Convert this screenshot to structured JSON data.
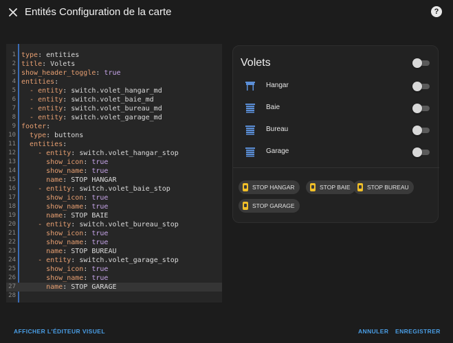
{
  "dialog": {
    "title": "Entités Configuration de la carte",
    "help_glyph": "?"
  },
  "yaml_lines": [
    {
      "n": "1",
      "parts": [
        [
          "k",
          "type"
        ],
        [
          "t",
          ": entities"
        ]
      ]
    },
    {
      "n": "2",
      "parts": [
        [
          "k",
          "title"
        ],
        [
          "t",
          ": Volets"
        ]
      ]
    },
    {
      "n": "3",
      "parts": [
        [
          "k",
          "show_header_toggle"
        ],
        [
          "t",
          ": "
        ],
        [
          "v",
          "true"
        ]
      ]
    },
    {
      "n": "4",
      "parts": [
        [
          "k",
          "entities"
        ],
        [
          "t",
          ":"
        ]
      ]
    },
    {
      "n": "5",
      "parts": [
        [
          "t",
          "  "
        ],
        [
          "d",
          "-"
        ],
        [
          "t",
          " "
        ],
        [
          "k",
          "entity"
        ],
        [
          "t",
          ": switch.volet_hangar_md"
        ]
      ]
    },
    {
      "n": "6",
      "parts": [
        [
          "t",
          "  "
        ],
        [
          "d",
          "-"
        ],
        [
          "t",
          " "
        ],
        [
          "k",
          "entity"
        ],
        [
          "t",
          ": switch.volet_baie_md"
        ]
      ]
    },
    {
      "n": "7",
      "parts": [
        [
          "t",
          "  "
        ],
        [
          "d",
          "-"
        ],
        [
          "t",
          " "
        ],
        [
          "k",
          "entity"
        ],
        [
          "t",
          ": switch.volet_bureau_md"
        ]
      ]
    },
    {
      "n": "8",
      "parts": [
        [
          "t",
          "  "
        ],
        [
          "d",
          "-"
        ],
        [
          "t",
          " "
        ],
        [
          "k",
          "entity"
        ],
        [
          "t",
          ": switch.volet_garage_md"
        ]
      ]
    },
    {
      "n": "9",
      "parts": [
        [
          "k",
          "footer"
        ],
        [
          "t",
          ":"
        ]
      ]
    },
    {
      "n": "10",
      "parts": [
        [
          "t",
          "  "
        ],
        [
          "k",
          "type"
        ],
        [
          "t",
          ": buttons"
        ]
      ]
    },
    {
      "n": "11",
      "parts": [
        [
          "t",
          "  "
        ],
        [
          "k",
          "entities"
        ],
        [
          "t",
          ":"
        ]
      ]
    },
    {
      "n": "12",
      "parts": [
        [
          "t",
          "    "
        ],
        [
          "d",
          "-"
        ],
        [
          "t",
          " "
        ],
        [
          "k",
          "entity"
        ],
        [
          "t",
          ": switch.volet_hangar_stop"
        ]
      ]
    },
    {
      "n": "13",
      "parts": [
        [
          "t",
          "      "
        ],
        [
          "k",
          "show_icon"
        ],
        [
          "t",
          ": "
        ],
        [
          "v",
          "true"
        ]
      ]
    },
    {
      "n": "14",
      "parts": [
        [
          "t",
          "      "
        ],
        [
          "k",
          "show_name"
        ],
        [
          "t",
          ": "
        ],
        [
          "v",
          "true"
        ]
      ]
    },
    {
      "n": "15",
      "parts": [
        [
          "t",
          "      "
        ],
        [
          "k",
          "name"
        ],
        [
          "t",
          ": STOP HANGAR"
        ]
      ]
    },
    {
      "n": "16",
      "parts": [
        [
          "t",
          "    "
        ],
        [
          "d",
          "-"
        ],
        [
          "t",
          " "
        ],
        [
          "k",
          "entity"
        ],
        [
          "t",
          ": switch.volet_baie_stop"
        ]
      ]
    },
    {
      "n": "17",
      "parts": [
        [
          "t",
          "      "
        ],
        [
          "k",
          "show_icon"
        ],
        [
          "t",
          ": "
        ],
        [
          "v",
          "true"
        ]
      ]
    },
    {
      "n": "18",
      "parts": [
        [
          "t",
          "      "
        ],
        [
          "k",
          "show_name"
        ],
        [
          "t",
          ": "
        ],
        [
          "v",
          "true"
        ]
      ]
    },
    {
      "n": "19",
      "parts": [
        [
          "t",
          "      "
        ],
        [
          "k",
          "name"
        ],
        [
          "t",
          ": STOP BAIE"
        ]
      ]
    },
    {
      "n": "20",
      "parts": [
        [
          "t",
          "    "
        ],
        [
          "d",
          "-"
        ],
        [
          "t",
          " "
        ],
        [
          "k",
          "entity"
        ],
        [
          "t",
          ": switch.volet_bureau_stop"
        ]
      ]
    },
    {
      "n": "21",
      "parts": [
        [
          "t",
          "      "
        ],
        [
          "k",
          "show_icon"
        ],
        [
          "t",
          ": "
        ],
        [
          "v",
          "true"
        ]
      ]
    },
    {
      "n": "22",
      "parts": [
        [
          "t",
          "      "
        ],
        [
          "k",
          "show_name"
        ],
        [
          "t",
          ": "
        ],
        [
          "v",
          "true"
        ]
      ]
    },
    {
      "n": "23",
      "parts": [
        [
          "t",
          "      "
        ],
        [
          "k",
          "name"
        ],
        [
          "t",
          ": STOP BUREAU"
        ]
      ]
    },
    {
      "n": "24",
      "parts": [
        [
          "t",
          "    "
        ],
        [
          "d",
          "-"
        ],
        [
          "t",
          " "
        ],
        [
          "k",
          "entity"
        ],
        [
          "t",
          ": switch.volet_garage_stop"
        ]
      ]
    },
    {
      "n": "25",
      "parts": [
        [
          "t",
          "      "
        ],
        [
          "k",
          "show_icon"
        ],
        [
          "t",
          ": "
        ],
        [
          "v",
          "true"
        ]
      ]
    },
    {
      "n": "26",
      "parts": [
        [
          "t",
          "      "
        ],
        [
          "k",
          "show_name"
        ],
        [
          "t",
          ": "
        ],
        [
          "v",
          "true"
        ]
      ]
    },
    {
      "n": "27",
      "parts": [
        [
          "t",
          "      "
        ],
        [
          "k",
          "name"
        ],
        [
          "t",
          ": STOP GARAGE"
        ]
      ]
    },
    {
      "n": "28",
      "parts": []
    }
  ],
  "active_line": "27",
  "card": {
    "title": "Volets",
    "header_toggle_on": false,
    "rows": [
      {
        "label": "Hangar",
        "icon": "shutter-open-icon",
        "on": false
      },
      {
        "label": "Baie",
        "icon": "shutter-closed-icon",
        "on": false
      },
      {
        "label": "Bureau",
        "icon": "shutter-closed-icon",
        "on": false
      },
      {
        "label": "Garage",
        "icon": "shutter-closed-icon",
        "on": false
      }
    ],
    "footer_buttons": [
      "STOP HANGAR",
      "STOP BAIE",
      "STOP BUREAU",
      "STOP GARAGE"
    ]
  },
  "footer": {
    "visual_editor": "AFFICHER L'ÉDITEUR VISUEL",
    "cancel": "ANNULER",
    "save": "ENREGISTRER"
  },
  "colors": {
    "accent": "#4a9ee6",
    "shutter_icon": "#5b8fd8",
    "stop_icon": "#f2c028"
  }
}
